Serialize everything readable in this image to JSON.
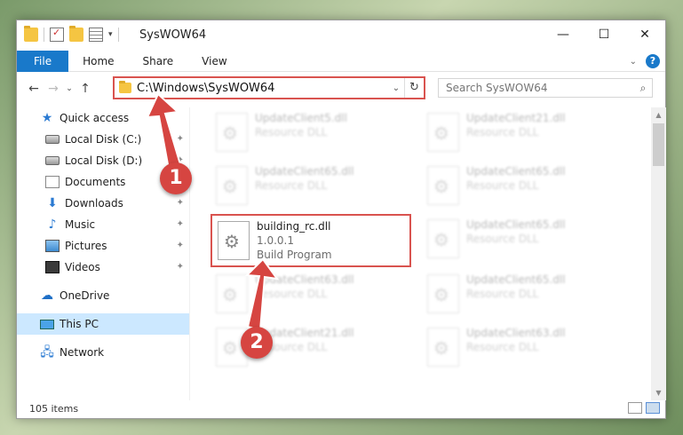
{
  "window": {
    "title": "SysWOW64",
    "controls": {
      "minimize": "—",
      "maximize": "☐",
      "close": "✕"
    }
  },
  "ribbon": {
    "tabs": [
      "File",
      "Home",
      "Share",
      "View"
    ],
    "help": "?",
    "collapse": "⌄"
  },
  "nav": {
    "back": "←",
    "forward": "→",
    "recent": "⌄",
    "up": "↑",
    "address": "C:\\Windows\\SysWOW64",
    "address_dropdown": "⌄",
    "refresh": "↻",
    "search_placeholder": "Search SysWOW64",
    "search_icon": "⌕"
  },
  "sidebar": {
    "items": [
      {
        "label": "Quick access",
        "icon": "star-icon",
        "pinned": false
      },
      {
        "label": "Local Disk (C:)",
        "icon": "disk-icon",
        "pinned": true
      },
      {
        "label": "Local Disk (D:)",
        "icon": "disk-icon",
        "pinned": true
      },
      {
        "label": "Documents",
        "icon": "document-icon",
        "pinned": true
      },
      {
        "label": "Downloads",
        "icon": "download-icon",
        "pinned": true
      },
      {
        "label": "Music",
        "icon": "music-icon",
        "pinned": true
      },
      {
        "label": "Pictures",
        "icon": "pictures-icon",
        "pinned": true
      },
      {
        "label": "Videos",
        "icon": "videos-icon",
        "pinned": true
      },
      {
        "label": "OneDrive",
        "icon": "cloud-icon",
        "pinned": false
      },
      {
        "label": "This PC",
        "icon": "pc-icon",
        "pinned": false,
        "selected": true
      },
      {
        "label": "Network",
        "icon": "network-icon",
        "pinned": false
      }
    ],
    "pin_glyph": "📌"
  },
  "files": [
    {
      "name": "UpdateClient5.dll",
      "sub1": "Resource DLL",
      "sub2": "",
      "blurred": true
    },
    {
      "name": "UpdateClient21.dll",
      "sub1": "Resource DLL",
      "sub2": "",
      "blurred": true
    },
    {
      "name": "UpdateClient65.dll",
      "sub1": "Resource DLL",
      "sub2": "",
      "blurred": true
    },
    {
      "name": "UpdateClient65.dll",
      "sub1": "Resource DLL",
      "sub2": "",
      "blurred": true
    },
    {
      "name": "building_rc.dll",
      "sub1": "1.0.0.1",
      "sub2": "Build Program",
      "blurred": false
    },
    {
      "name": "UpdateClient65.dll",
      "sub1": "Resource DLL",
      "sub2": "",
      "blurred": true
    },
    {
      "name": "UpdateClient63.dll",
      "sub1": "Resource DLL",
      "sub2": "",
      "blurred": true
    },
    {
      "name": "UpdateClient65.dll",
      "sub1": "Resource DLL",
      "sub2": "",
      "blurred": true
    },
    {
      "name": "UpdateClient21.dll",
      "sub1": "Resource DLL",
      "sub2": "",
      "blurred": true
    },
    {
      "name": "UpdateClient63.dll",
      "sub1": "Resource DLL",
      "sub2": "",
      "blurred": true
    }
  ],
  "status": {
    "count": "105 items"
  },
  "callouts": [
    "1",
    "2"
  ],
  "colors": {
    "accent": "#1979ca",
    "highlight": "#d9534f",
    "selected": "#cce8ff"
  }
}
